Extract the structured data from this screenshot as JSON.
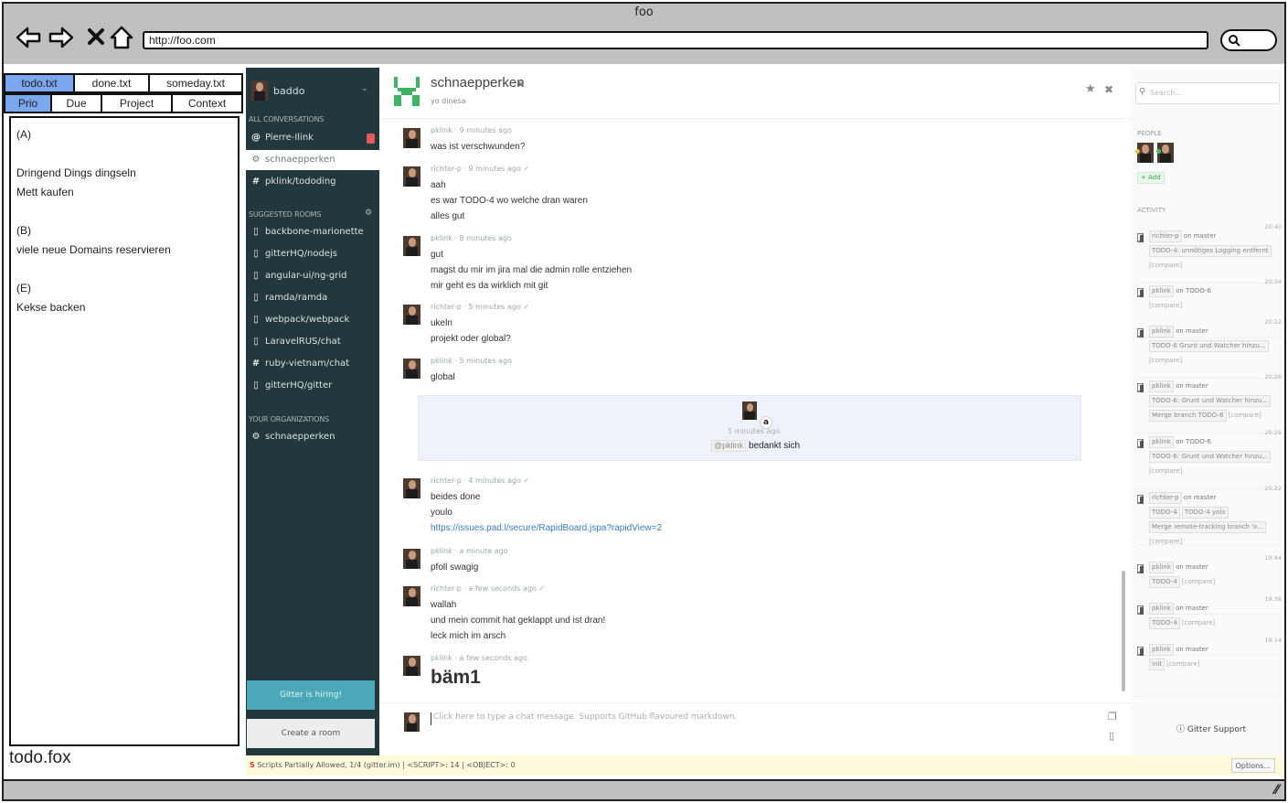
{
  "window": {
    "title": "foo",
    "url": "http://foo.com"
  },
  "todo": {
    "files": [
      "todo.txt",
      "done.txt",
      "someday.txt"
    ],
    "sorts": [
      "Prio",
      "Due",
      "Project",
      "Context"
    ],
    "lines": [
      "(A)",
      "",
      "Dringend Dings dingseln",
      "Mett kaufen",
      "",
      "(B)",
      "viele neue Domains reservieren",
      "",
      "(E)",
      "Kekse backen"
    ],
    "app_name": "todo.fox"
  },
  "sidebar": {
    "user": "baddo",
    "all_conversations": "ALL CONVERSATIONS",
    "conversations": [
      {
        "icon": "@",
        "label": "Pierre-Ilink"
      },
      {
        "icon": "⚙",
        "label": "schnaepperken"
      },
      {
        "icon": "#",
        "label": "pklink/tododing"
      }
    ],
    "suggested_rooms": "SUGGESTED ROOMS",
    "suggested": [
      {
        "icon": "▯",
        "label": "backbone-marionette"
      },
      {
        "icon": "▯",
        "label": "gitterHQ/nodejs"
      },
      {
        "icon": "▯",
        "label": "angular-ui/ng-grid"
      },
      {
        "icon": "▯",
        "label": "ramda/ramda"
      },
      {
        "icon": "▯",
        "label": "webpack/webpack"
      },
      {
        "icon": "▯",
        "label": "LaravelRUS/chat"
      },
      {
        "icon": "#",
        "label": "ruby-vietnam/chat"
      },
      {
        "icon": "▯",
        "label": "gitterHQ/gitter"
      }
    ],
    "your_orgs": "YOUR ORGANIZATIONS",
    "orgs": [
      {
        "icon": "⚙",
        "label": "schnaepperken"
      }
    ],
    "hiring": "Gitter is hiring!",
    "create_room": "Create a room"
  },
  "chat": {
    "room": "schnaepperken",
    "topic": "yo dinesa",
    "messages": [
      {
        "user": "pklink",
        "time": "9 minutes ago",
        "lines": [
          "was ist verschwunden?"
        ]
      },
      {
        "user": "richter-p",
        "time": "9 minutes ago ✓",
        "lines": [
          "aah",
          "es war TODO-4 wo welche dran waren",
          "alles gut"
        ]
      },
      {
        "user": "pklink",
        "time": "8 minutes ago",
        "lines": [
          "gut",
          "magst du mir im jira mal die admin rolle entziehen",
          "mir geht es da wirklich mit git"
        ]
      },
      {
        "user": "richter-p",
        "time": "5 minutes ago ✓",
        "lines": [
          "ukeln",
          "projekt oder global?"
        ]
      },
      {
        "user": "pklink",
        "time": "5 minutes ago",
        "lines": [
          "global"
        ]
      },
      {
        "user": "richter-p",
        "time": "4 minutes ago ✓",
        "lines": [
          "beides done",
          "youlo",
          "https://issues.pad.l/secure/RapidBoard.jspa?rapidView=2"
        ]
      },
      {
        "user": "pklink",
        "time": "a minute ago",
        "lines": [
          "pfoll swagig"
        ]
      },
      {
        "user": "richter-p",
        "time": "a few seconds ago ✓",
        "lines": [
          "wallah",
          "und mein commit hat geklappt und ist dran!",
          "leck mich im arsch"
        ]
      },
      {
        "user": "pklink",
        "time": "a few seconds ago",
        "lines": [
          "bäm1"
        ]
      }
    ],
    "notice": {
      "time": "5 minutes ago",
      "mention": "@pklink",
      "text": "bedankt sich"
    },
    "input_placeholder": "Click here to type a chat message. Supports GitHub flavoured markdown."
  },
  "right": {
    "search_placeholder": "Search...",
    "people": "PEOPLE",
    "add": "+ Add",
    "activity": "ACTIVITY",
    "items": [
      {
        "who": "richter-p",
        "where": "on master",
        "time": "20:40",
        "chips": [
          "TODO-4: unnötiges Logging entfernt"
        ],
        "extra": "[compare]"
      },
      {
        "who": "pklink",
        "where": "on TODO-6",
        "time": "20:34",
        "chips": [],
        "extra": "[compare]"
      },
      {
        "who": "pklink",
        "where": "on master",
        "time": "20:22",
        "chips": [
          "TODO-6 Grunt und Watcher hinzu..."
        ],
        "extra": "[compare]"
      },
      {
        "who": "pklink",
        "where": "on master",
        "time": "20:26",
        "chips": [
          "TODO-6: Grunt und Watcher hinzu...",
          "Merge branch TODO-6"
        ],
        "extra": "[compare]"
      },
      {
        "who": "pklink",
        "where": "on TODO-6",
        "time": "20:25",
        "chips": [
          "TODO-6: Grunt und Watcher hinzu..."
        ],
        "extra": "[compare]"
      },
      {
        "who": "richter-p",
        "where": "on master",
        "time": "20:22",
        "chips": [
          "TODO-4",
          "TODO-4 yolo",
          "Merge remote-tracking branch 'o..."
        ],
        "extra": "[compare]"
      },
      {
        "who": "pklink",
        "where": "on master",
        "time": "19:44",
        "chips": [
          "TODO-4"
        ],
        "extra": "[compare]"
      },
      {
        "who": "pklink",
        "where": "on master",
        "time": "19:38",
        "chips": [
          "TODO-4"
        ],
        "extra": "[compare]"
      },
      {
        "who": "pklink",
        "where": "on master",
        "time": "19:14",
        "chips": [
          "init"
        ],
        "extra": "[compare]"
      }
    ],
    "support": "Gitter Support"
  },
  "statusbar": {
    "text": "Scripts Partially Allowed, 1/4 (gitter.im) | <SCRIPT>: 14 | <OBJECT>: 0",
    "options": "Options..."
  }
}
